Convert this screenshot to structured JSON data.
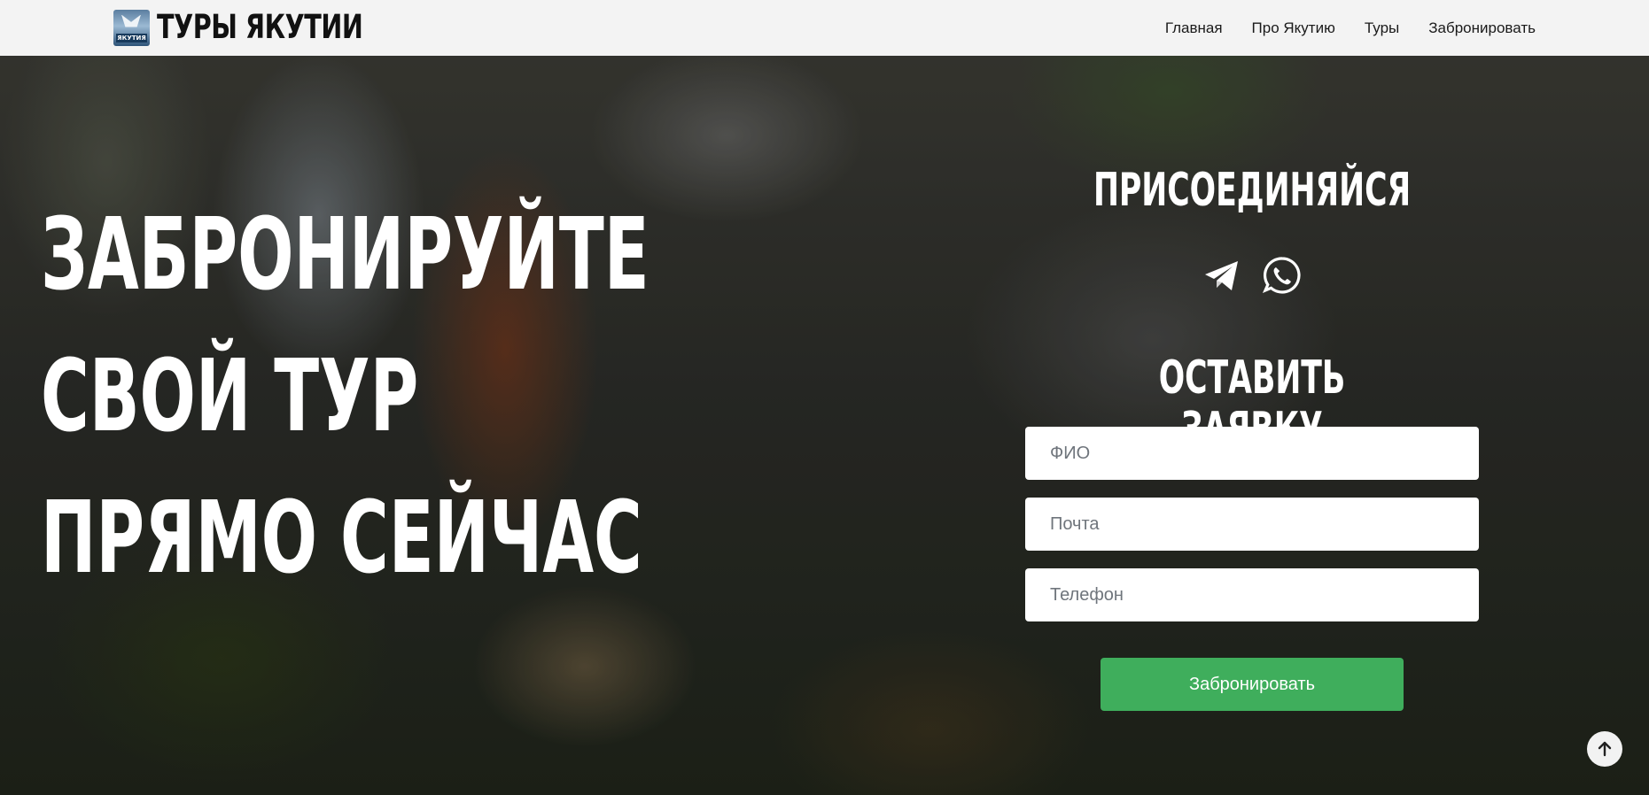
{
  "header": {
    "logo_text": "ТУРЫ ЯКУТИИ",
    "logo_badge": "ЯКУТИЯ",
    "nav": [
      {
        "label": "Главная"
      },
      {
        "label": "Про Якутию"
      },
      {
        "label": "Туры"
      },
      {
        "label": "Забронировать"
      }
    ]
  },
  "hero": {
    "title_lines": [
      "ЗАБРОНИРУЙТЕ",
      "СВОЙ ТУР",
      "ПРЯМО СЕЙЧАС"
    ]
  },
  "panel": {
    "join_title": "ПРИСОЕДИНЯЙСЯ",
    "socials": [
      {
        "icon": "telegram-icon"
      },
      {
        "icon": "whatsapp-icon"
      }
    ],
    "form_title": "ОСТАВИТЬ ЗАЯВКУ",
    "fields": {
      "name_placeholder": "ФИО",
      "email_placeholder": "Почта",
      "phone_placeholder": "Телефон"
    },
    "submit_label": "Забронировать"
  },
  "colors": {
    "header_bg": "#f3f3f3",
    "submit_bg": "#3fae5c",
    "title_text": "#ffffff"
  },
  "scroll_top": {
    "icon": "arrow-up-icon"
  }
}
